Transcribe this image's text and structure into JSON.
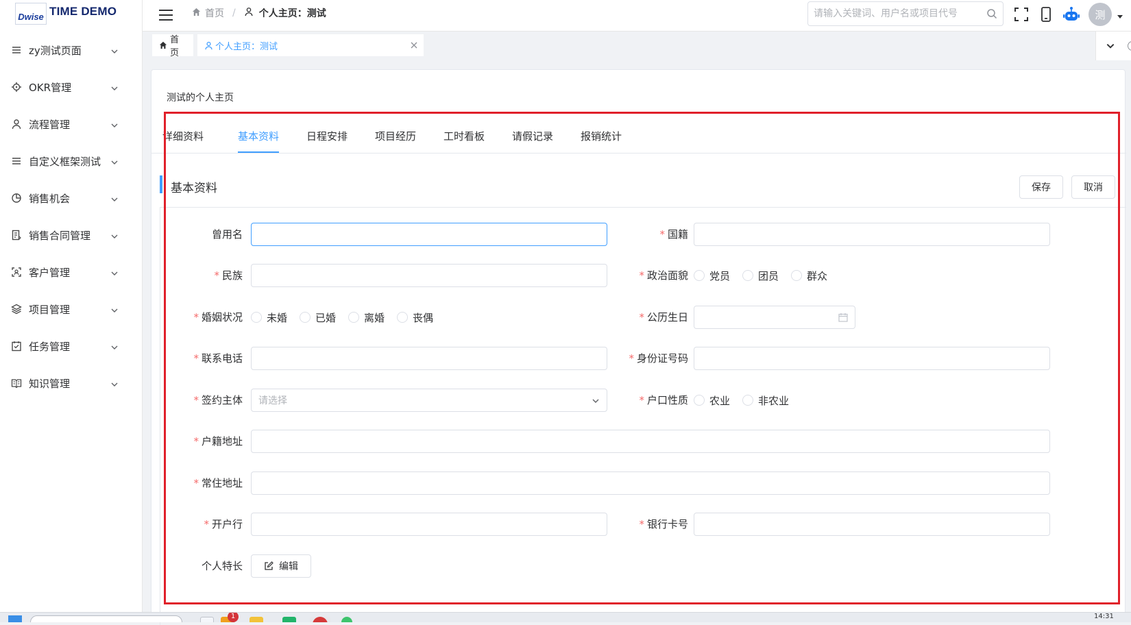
{
  "logo": {
    "mark": "Dwise",
    "text": "TIME DEMO"
  },
  "sidebar": {
    "items": [
      {
        "label": "zy测试页面",
        "icon": "list-icon"
      },
      {
        "label": "OKR管理",
        "icon": "target-icon"
      },
      {
        "label": "流程管理",
        "icon": "user-icon"
      },
      {
        "label": "自定义框架测试",
        "icon": "list-icon"
      },
      {
        "label": "销售机会",
        "icon": "pie-chart-icon"
      },
      {
        "label": "销售合同管理",
        "icon": "contract-icon"
      },
      {
        "label": "客户管理",
        "icon": "customer-icon"
      },
      {
        "label": "项目管理",
        "icon": "layers-icon"
      },
      {
        "label": "任务管理",
        "icon": "checklist-icon"
      },
      {
        "label": "知识管理",
        "icon": "book-icon"
      }
    ]
  },
  "header": {
    "breadcrumb_home": "首页",
    "breadcrumb_sep": "/",
    "breadcrumb_current": "个人主页：测试",
    "search_placeholder": "请输入关键词、用户名或项目代号",
    "avatar_text": "测"
  },
  "tags": {
    "home": "首页",
    "active": "个人主页：测试"
  },
  "page": {
    "title": "测试的个人主页",
    "tabs": [
      "详细资料",
      "基本资料",
      "日程安排",
      "项目经历",
      "工时看板",
      "请假记录",
      "报销统计"
    ],
    "active_tab": "基本资料",
    "section_title": "基本资料",
    "save_label": "保存",
    "cancel_label": "取消"
  },
  "form": {
    "former_name": {
      "label": "曾用名",
      "value": ""
    },
    "nationality": {
      "label": "国籍",
      "value": ""
    },
    "ethnicity": {
      "label": "民族",
      "value": ""
    },
    "political": {
      "label": "政治面貌",
      "options": [
        "党员",
        "团员",
        "群众"
      ]
    },
    "marital": {
      "label": "婚姻状况",
      "options": [
        "未婚",
        "已婚",
        "离婚",
        "丧偶"
      ]
    },
    "birthday": {
      "label": "公历生日",
      "value": ""
    },
    "phone": {
      "label": "联系电话",
      "value": ""
    },
    "id_number": {
      "label": "身份证号码",
      "value": ""
    },
    "contract_entity": {
      "label": "签约主体",
      "placeholder": "请选择"
    },
    "household_type": {
      "label": "户口性质",
      "options": [
        "农业",
        "非农业"
      ]
    },
    "household_address": {
      "label": "户籍地址",
      "value": ""
    },
    "residence_address": {
      "label": "常住地址",
      "value": ""
    },
    "bank": {
      "label": "开户行",
      "value": ""
    },
    "bank_card": {
      "label": "银行卡号",
      "value": ""
    },
    "specialty": {
      "label": "个人特长",
      "edit_label": "编辑"
    }
  },
  "taskbar": {
    "badge": "1",
    "time": "14:31"
  },
  "colors": {
    "accent": "#409eff",
    "required": "#f56c6c",
    "highlight": "#e0202a"
  }
}
